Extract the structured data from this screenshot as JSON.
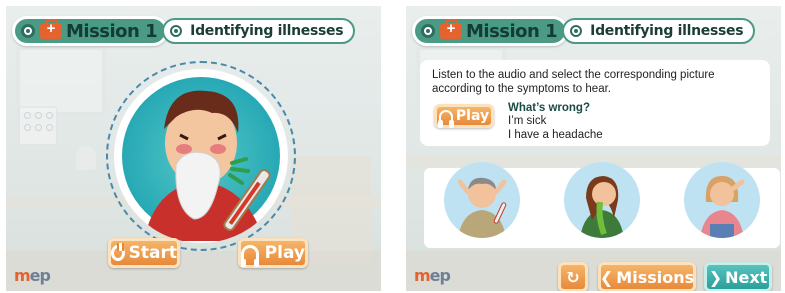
{
  "left_screen": {
    "mission_label": "Mission 1",
    "title": "Identifying illnesses",
    "start_label": "Start",
    "play_label": "Play",
    "logo_text": "mep"
  },
  "right_screen": {
    "mission_label": "Mission 1",
    "title": "Identifying illnesses",
    "instruction": "Listen to the audio and select the corresponding picture according to the symptoms to hear.",
    "play_label": "Play",
    "question": "What’s wrong?",
    "answer_line1": "I’m sick",
    "answer_line2": "I have a headache",
    "options": [
      {
        "icon": "boy-with-fever-icon"
      },
      {
        "icon": "girl-vomiting-icon"
      },
      {
        "icon": "girl-with-headache-icon"
      }
    ],
    "missions_label": "Missions",
    "next_label": "Next",
    "logo_text": "mep"
  },
  "colors": {
    "header_green": "#4b9a86",
    "button_orange": "#e8893a",
    "button_teal": "#2a9f9c"
  }
}
